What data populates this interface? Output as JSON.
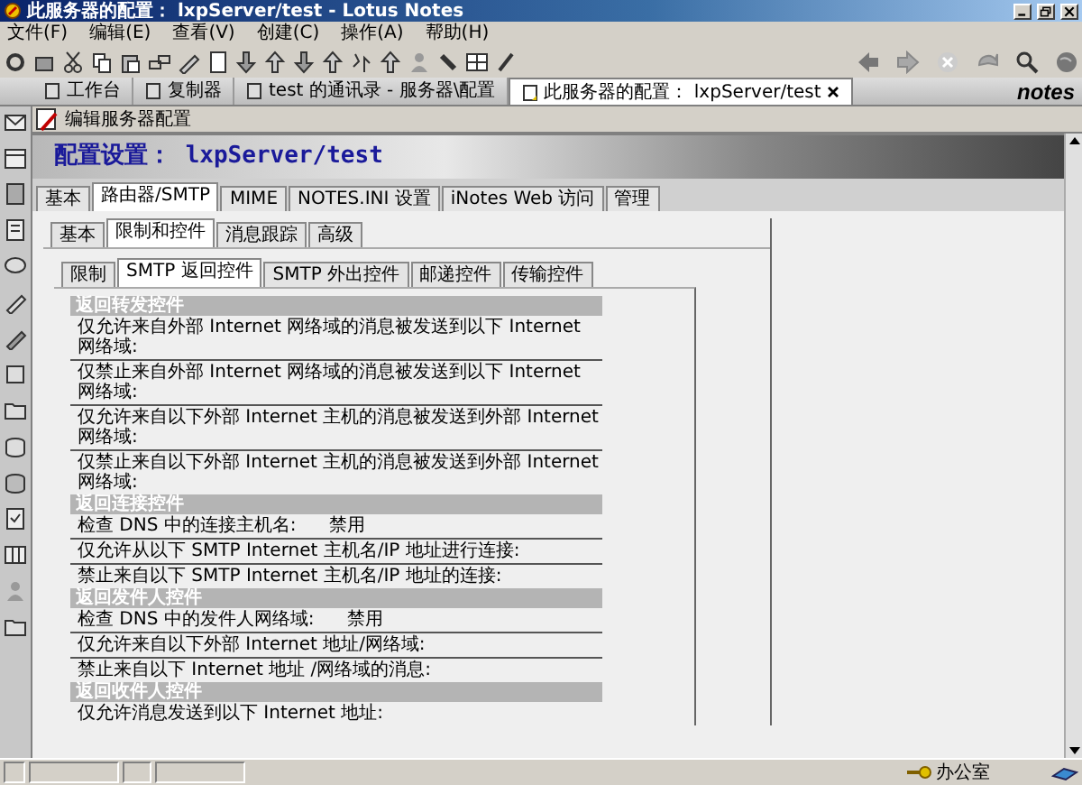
{
  "window": {
    "title": "此服务器的配置： lxpServer/test - Lotus Notes"
  },
  "menu": [
    "文件(F)",
    "编辑(E)",
    "查看(V)",
    "创建(C)",
    "操作(A)",
    "帮助(H)"
  ],
  "window_tabs": [
    {
      "label": "工作台",
      "selected": false
    },
    {
      "label": "复制器",
      "selected": false
    },
    {
      "label": "test 的通讯录 - 服务器\\配置",
      "selected": false
    },
    {
      "label": "此服务器的配置： lxpServer/test",
      "selected": true
    }
  ],
  "brand": "notes",
  "action_bar": {
    "button": "编辑服务器配置"
  },
  "document": {
    "title": "配置设置： lxpServer/test",
    "tabs": [
      {
        "label": "基本",
        "selected": false
      },
      {
        "label": "路由器/SMTP",
        "selected": true
      },
      {
        "label": "MIME",
        "selected": false
      },
      {
        "label": "NOTES.INI 设置",
        "selected": false
      },
      {
        "label": "iNotes Web 访问",
        "selected": false
      },
      {
        "label": "管理",
        "selected": false
      }
    ],
    "subtabs": [
      {
        "label": "基本",
        "selected": false
      },
      {
        "label": "限制和控件",
        "selected": true
      },
      {
        "label": "消息跟踪",
        "selected": false
      },
      {
        "label": "高级",
        "selected": false
      }
    ],
    "subsubtabs": [
      {
        "label": "限制",
        "selected": false
      },
      {
        "label": "SMTP 返回控件",
        "selected": true
      },
      {
        "label": "SMTP 外出控件",
        "selected": false
      },
      {
        "label": "邮递控件",
        "selected": false
      },
      {
        "label": "传输控件",
        "selected": false
      }
    ],
    "sections": [
      {
        "title": "返回转发控件",
        "fields": [
          {
            "label": "仅允许来自外部 Internet 网络域的消息被发送到以下 Internet 网络域:"
          },
          {
            "label": "仅禁止来自外部 Internet 网络域的消息被发送到以下 Internet 网络域:"
          },
          {
            "label": "仅允许来自以下外部 Internet 主机的消息被发送到外部 Internet 网络域:"
          },
          {
            "label": "仅禁止来自以下外部 Internet 主机的消息被发送到外部 Internet 网络域:"
          }
        ]
      },
      {
        "title": "返回连接控件",
        "fields": [
          {
            "label": "检查 DNS 中的连接主机名:",
            "value": "禁用"
          },
          {
            "label": "仅允许从以下 SMTP Internet 主机名/IP 地址进行连接:"
          },
          {
            "label": "禁止来自以下 SMTP Internet 主机名/IP 地址的连接:"
          }
        ]
      },
      {
        "title": "返回发件人控件",
        "fields": [
          {
            "label": "检查 DNS 中的发件人网络域:",
            "value": "禁用"
          },
          {
            "label": "仅允许来自以下外部 Internet 地址/网络域:"
          },
          {
            "label": "禁止来自以下 Internet 地址 /网络域的消息:"
          }
        ]
      },
      {
        "title": "返回收件人控件",
        "fields": [
          {
            "label": "仅允许消息发送到以下 Internet 地址:"
          }
        ]
      }
    ]
  },
  "status_bar": {
    "location": "办公室"
  }
}
